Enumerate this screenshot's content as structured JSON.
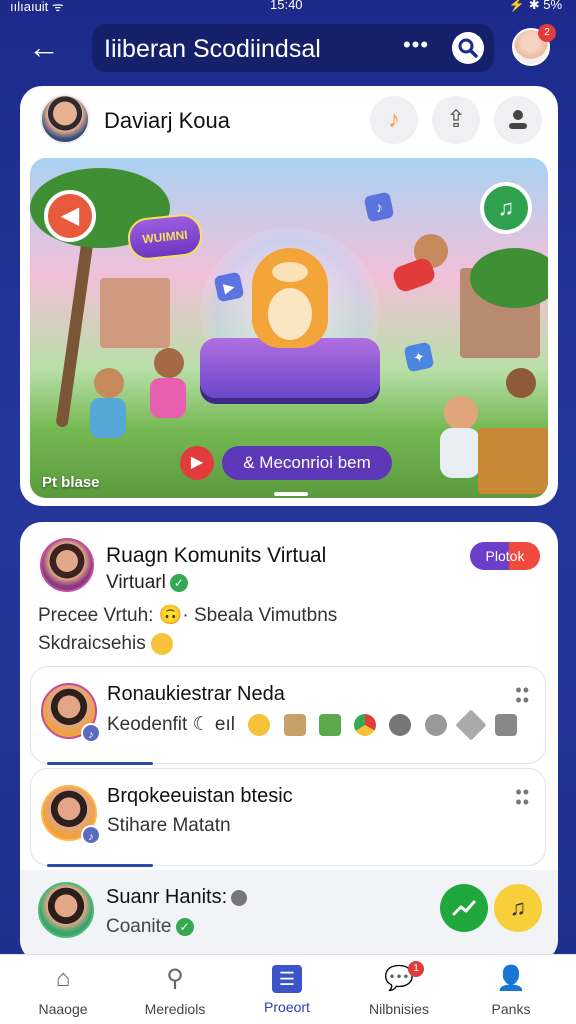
{
  "status_bar": {
    "left": "ıılıaıuit ᯤ",
    "center": "15:40",
    "right": "⚡ ✱ 5%"
  },
  "header": {
    "back_label": "←",
    "title": "Iiiberan Scodiindsal",
    "more_label": "•••",
    "search_icon": "search-icon",
    "notification_count": "2"
  },
  "user": {
    "name": "Daviarj Koua"
  },
  "top_icons": [
    {
      "icon": "music-icon",
      "glyph": "♪"
    },
    {
      "icon": "share-icon",
      "glyph": "⇪"
    },
    {
      "icon": "person-icon",
      "glyph": "👤"
    }
  ],
  "banner": {
    "tag": "WUIMNI",
    "left_sticker": "◀",
    "right_sticker": "♫",
    "play_glyph": "▶",
    "action_label": "& Meconrioi bem",
    "caption": "Pt blase"
  },
  "room": {
    "title": "Ruagn Komunits Virtual",
    "subtitle": "Virtuarl",
    "badge": "Plotok",
    "description_line1": "Precee Vrtuh: 🙃· Sbeala Vimutbns",
    "description_line2": "Skdraicsehis"
  },
  "list": [
    {
      "title": "Ronaukiestrar Neda",
      "subtitle": "Keodenfit ☾ eıl"
    },
    {
      "title": "Brqokeeuistan btesic",
      "subtitle": "Stihare Matatn"
    }
  ],
  "bottom_item": {
    "title": "Suanr Hanits:",
    "subtitle": "Coanite"
  },
  "nav": [
    {
      "label": "Naaoge",
      "icon": "home-icon",
      "glyph": "⌂"
    },
    {
      "label": "Merediols",
      "icon": "search-icon",
      "glyph": "⚲"
    },
    {
      "label": "Proeort",
      "icon": "list-icon",
      "glyph": "☰"
    },
    {
      "label": "Nilbnisies",
      "icon": "chat-icon",
      "glyph": "💬",
      "badge": "1"
    },
    {
      "label": "Panks",
      "icon": "profile-icon",
      "glyph": "👤"
    }
  ],
  "colors": {
    "accent": "#2a3fb0",
    "background": "#1d2a8c",
    "live_red": "#ef4a3d",
    "live_purple": "#6b3fc9"
  }
}
